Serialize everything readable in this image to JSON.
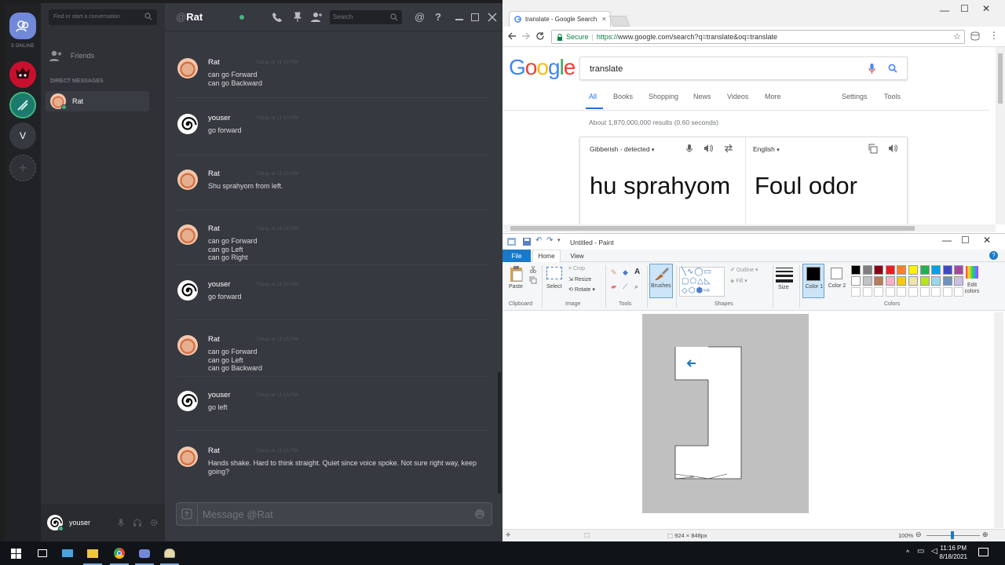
{
  "discord": {
    "online_count": "3 ONLINE",
    "guild_initial": "V",
    "dm_search_placeholder": "Find or start a conversation",
    "friends_label": "Friends",
    "direct_messages_header": "DIRECT MESSAGES",
    "dm_contact": "Rat",
    "chat_title_at": "@",
    "chat_title": "Rat",
    "header_search_placeholder": "Search",
    "self_username": "youser",
    "composer_placeholder": "Message @Rat",
    "messages": [
      {
        "author": "Rat",
        "ts": "Today at 11:14 PM",
        "lines": [
          "can go Forward",
          "can go Backward"
        ],
        "avatar": "rat"
      },
      {
        "author": "youser",
        "ts": "Today at 11:14 PM",
        "lines": [
          "go forward"
        ],
        "avatar": "spiral"
      },
      {
        "author": "Rat",
        "ts": "Today at 11:15 PM",
        "lines": [
          "Shu sprahyom from left."
        ],
        "avatar": "rat"
      },
      {
        "author": "Rat",
        "ts": "Today at 11:15 PM",
        "lines": [
          "can go Forward",
          "can go Left",
          "can go Right"
        ],
        "avatar": "rat"
      },
      {
        "author": "youser",
        "ts": "Today at 11:15 PM",
        "lines": [
          "go forward"
        ],
        "avatar": "spiral"
      },
      {
        "author": "Rat",
        "ts": "Today at 11:15 PM",
        "lines": [
          "can go Forward",
          "can go Left",
          "can go Backward"
        ],
        "avatar": "rat"
      },
      {
        "author": "youser",
        "ts": "Today at 11:16 PM",
        "lines": [
          "go left"
        ],
        "avatar": "spiral"
      },
      {
        "author": "Rat",
        "ts": "Today at 11:16 PM",
        "lines": [
          "Hands shake. Hard to think straight. Quiet since voice spoke. Not sure right way, keep going?"
        ],
        "avatar": "rat"
      }
    ]
  },
  "chrome": {
    "tab_title": "translate - Google Search",
    "secure_label": "Secure",
    "url_proto": "https://",
    "url_rest": "www.google.com/search?q=translate&oq=translate",
    "search_query": "translate",
    "tabs": [
      "All",
      "Books",
      "Shopping",
      "News",
      "Videos",
      "More",
      "Settings",
      "Tools"
    ],
    "result_stats": "About 1,870,000,000 results (0.60 seconds)",
    "source_lang": "Gibberish - detected",
    "target_lang": "English",
    "source_text": "hu sprahyom",
    "target_text": "Foul odor"
  },
  "paint": {
    "title": "Untitled - Paint",
    "tab_file": "File",
    "tab_home": "Home",
    "tab_view": "View",
    "paste": "Paste",
    "clipboard": "Clipboard",
    "crop": "Crop",
    "resize": "Resize",
    "rotate": "Rotate",
    "select": "Select",
    "image": "Image",
    "tools": "Tools",
    "brushes": "Brushes",
    "outline": "Outline",
    "fill": "Fill",
    "shapes": "Shapes",
    "size": "Size",
    "color1": "Color 1",
    "color2": "Color 2",
    "edit_colors": "Edit colors",
    "colors": "Colors",
    "dimensions": "924 × 848px",
    "zoom": "100%",
    "palette": [
      "#000000",
      "#7f7f7f",
      "#880015",
      "#ed1c24",
      "#ff7f27",
      "#fff200",
      "#22b14c",
      "#00a2e8",
      "#3f48cc",
      "#a349a4",
      "#ffffff",
      "#c3c3c3",
      "#b97a57",
      "#ffaec9",
      "#ffc90e",
      "#efe4b0",
      "#b5e61d",
      "#99d9ea",
      "#7092be",
      "#c8bfe7"
    ]
  },
  "taskbar": {
    "time": "11:16 PM",
    "date": "8/18/2021"
  }
}
